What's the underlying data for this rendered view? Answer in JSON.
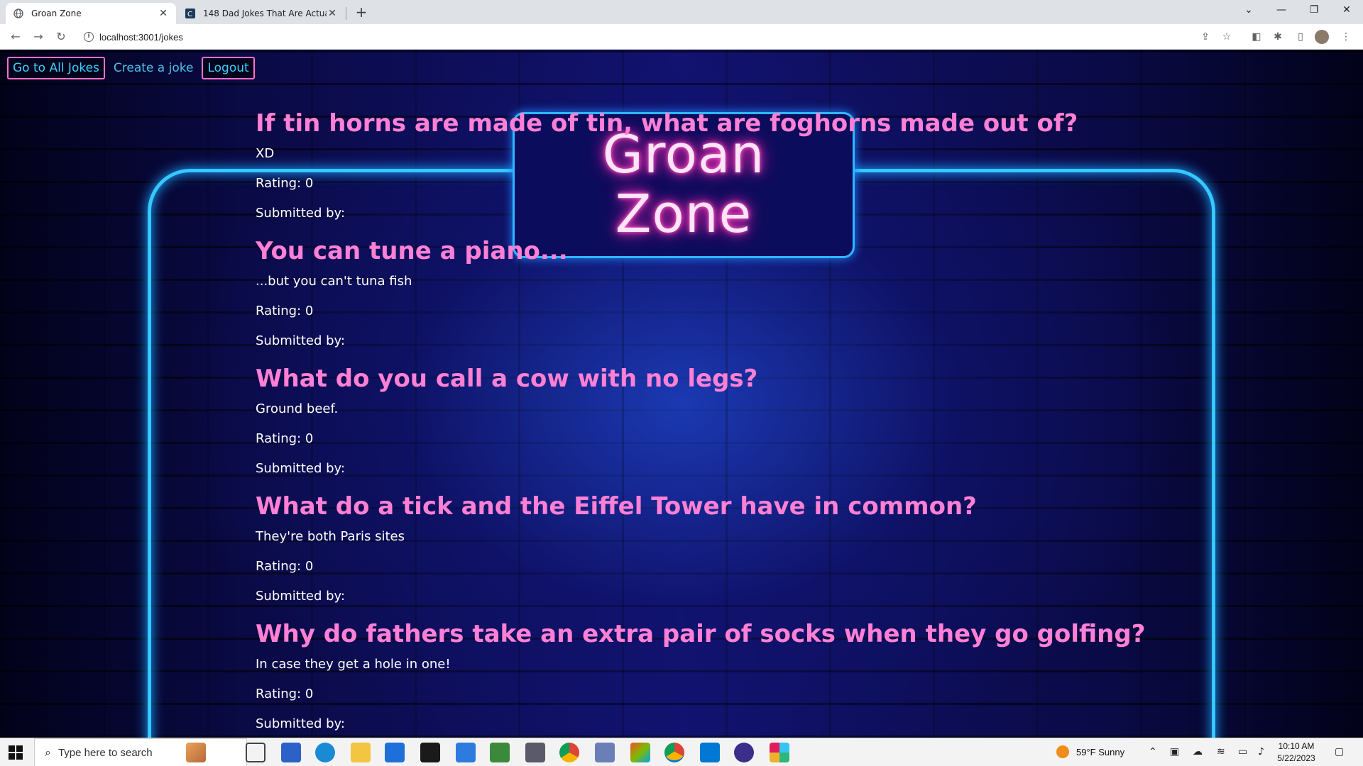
{
  "browser": {
    "tabs": [
      {
        "title": "Groan Zone",
        "active": true
      },
      {
        "title": "148 Dad Jokes That Are Actually",
        "active": false
      }
    ],
    "url": "localhost:3001/jokes"
  },
  "nav": {
    "all_jokes": "Go to All Jokes",
    "create": "Create a joke",
    "logout": "Logout"
  },
  "logo": {
    "line1": "Groan",
    "line2": "Zone"
  },
  "jokes": [
    {
      "setup": "If tin horns are made of tin, what are foghorns made out of?",
      "punchline": "XD",
      "rating": "Rating: 0",
      "submitted": "Submitted by:"
    },
    {
      "setup": "You can tune a piano...",
      "punchline": "...but you can't tuna fish",
      "rating": "Rating: 0",
      "submitted": "Submitted by:"
    },
    {
      "setup": "What do you call a cow with no legs?",
      "punchline": "Ground beef.",
      "rating": "Rating: 0",
      "submitted": "Submitted by:"
    },
    {
      "setup": "What do a tick and the Eiffel Tower have in common?",
      "punchline": "They're both Paris sites",
      "rating": "Rating: 0",
      "submitted": "Submitted by:"
    },
    {
      "setup": "Why do fathers take an extra pair of socks when they go golfing?",
      "punchline": "In case they get a hole in one!",
      "rating": "Rating: 0",
      "submitted": "Submitted by:"
    }
  ],
  "taskbar": {
    "search_placeholder": "Type here to search",
    "weather": "59°F  Sunny",
    "time": "10:10 AM",
    "date": "5/22/2023"
  }
}
